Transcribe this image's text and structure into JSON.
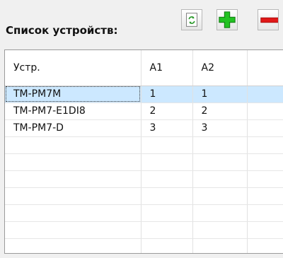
{
  "device_list": {
    "title": "Список устройств:",
    "toolbar": {
      "refresh_icon": "refresh-icon",
      "add_icon": "plus-icon",
      "remove_icon": "minus-icon",
      "refresh_color": "#2e9b2e",
      "add_color": "#1fb31f",
      "remove_color": "#e01818"
    },
    "columns": [
      "Устр.",
      "А1",
      "А2",
      ""
    ],
    "rows": [
      {
        "device": "TM-PM7M",
        "a1": "1",
        "a2": "1",
        "selected": true
      },
      {
        "device": "TM-PM7-E1DI8",
        "a1": "2",
        "a2": "2",
        "selected": false
      },
      {
        "device": "TM-PM7-D",
        "a1": "3",
        "a2": "3",
        "selected": false
      }
    ],
    "selection_color": "#cce8ff"
  }
}
